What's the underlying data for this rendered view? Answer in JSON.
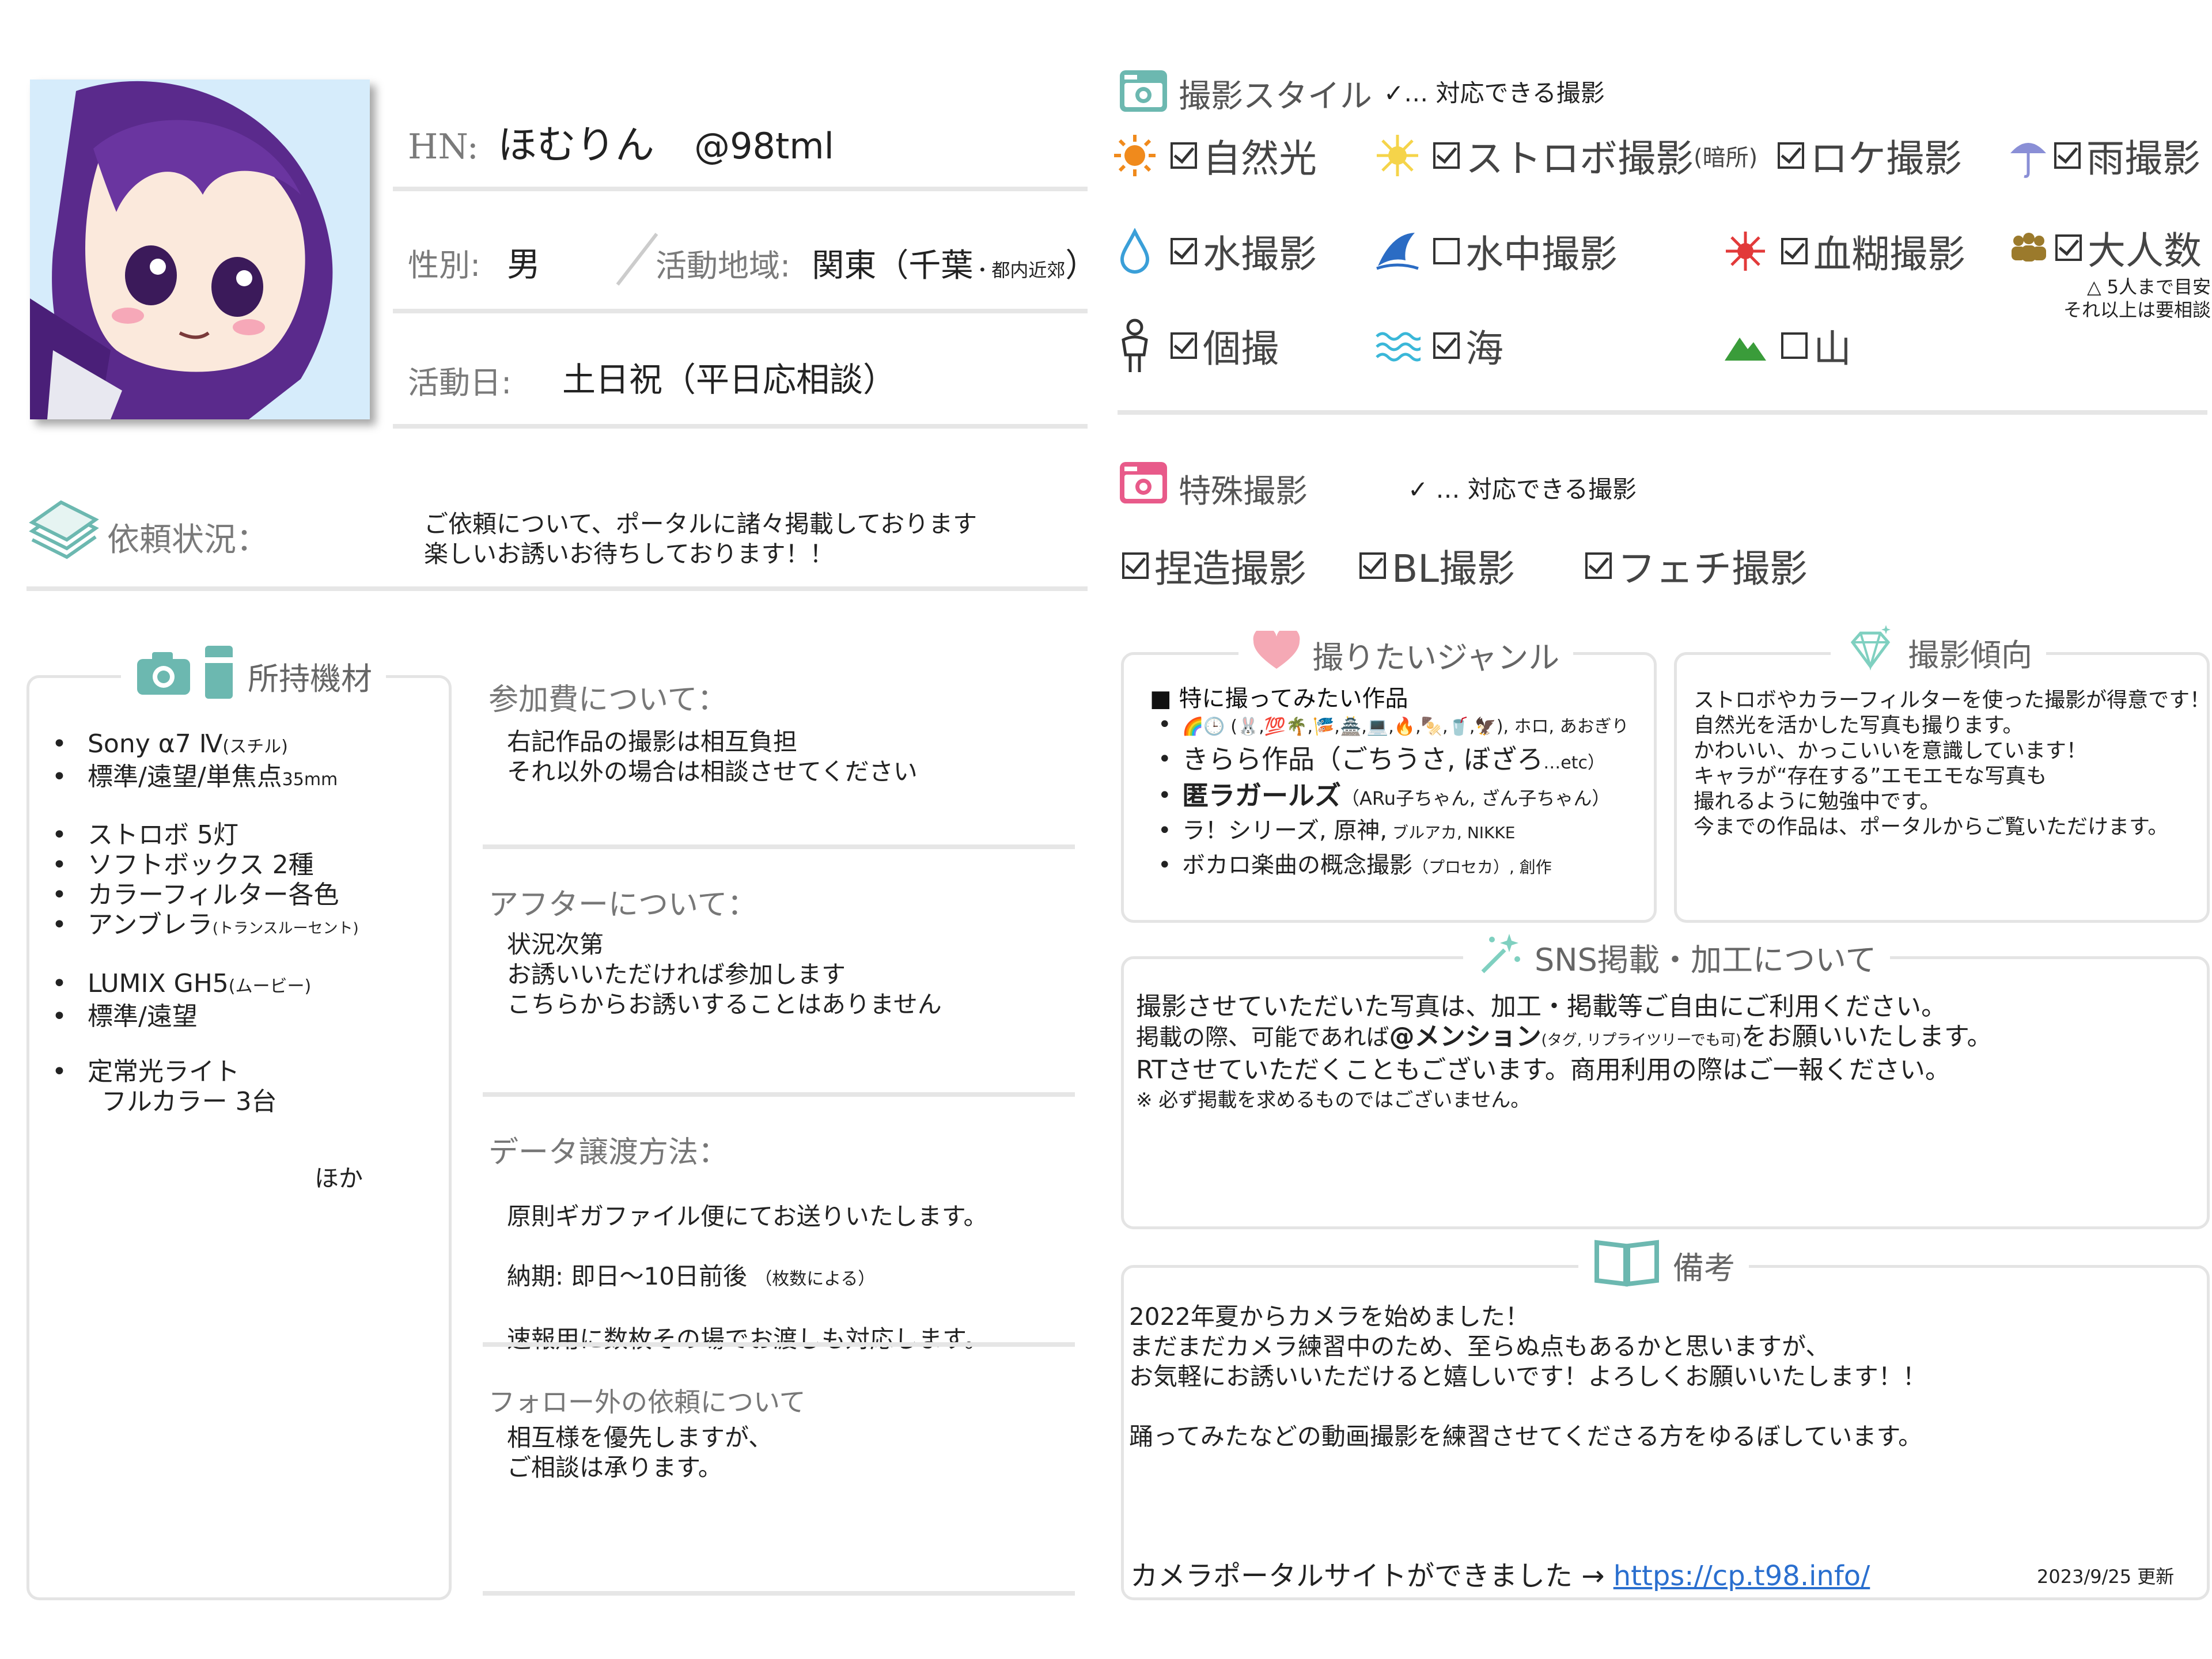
{
  "profile": {
    "hn_label": "HN:",
    "hn_name": "ほむりん",
    "handle": "@98tml",
    "gender_label": "性別:",
    "gender": "男",
    "area_label": "活動地域:",
    "area_main": "関東（千葉",
    "area_sub": "・都内近郊",
    "area_close": "）",
    "days_label": "活動日:",
    "days": "土日祝（平日応相談）"
  },
  "request": {
    "label": "依頼状況：",
    "lines": [
      "ご依頼について、ポータルに諸々掲載しております",
      "楽しいお誘いお待ちしております！！"
    ]
  },
  "equipment": {
    "title": "所持機材",
    "items": [
      {
        "text": "Sony α7 Ⅳ",
        "small": "(スチル)"
      },
      {
        "text": "標準/遠望/単焦点",
        "small": "35mm"
      },
      {
        "text": "ストロボ 5灯",
        "small": ""
      },
      {
        "text": "ソフトボックス 2種",
        "small": ""
      },
      {
        "text": "カラーフィルター各色",
        "small": ""
      },
      {
        "text": "アンブレラ",
        "small": "(トランスルーセント)"
      },
      {
        "text": "LUMIX GH5",
        "small": "(ムービー)"
      },
      {
        "text": "標準/遠望",
        "small": ""
      },
      {
        "text": "定常光ライト",
        "small": ""
      }
    ],
    "sub_item": "フルカラー 3台",
    "etc": "ほか"
  },
  "sections": [
    {
      "heading": "参加費について：",
      "body": "右記作品の撮影は相互負担\nそれ以外の場合は相談させてください"
    },
    {
      "heading": "アフターについて：",
      "body": "状況次第\nお誘いいただければ参加します\nこちらからお誘いすることはありません"
    },
    {
      "heading": "データ譲渡方法：",
      "body_lines": [
        "原則ギガファイル便にてお送りいたします。",
        "納期: 即日〜10日前後",
        "速報用に数枚その場でお渡しも対応します。"
      ],
      "body_small": "（枚数による）"
    },
    {
      "heading": "フォロー外の依頼について",
      "body": "相互様を優先しますが、\nご相談は承ります。"
    }
  ],
  "shoot_style": {
    "title": "撮影スタイル",
    "legend": "✓… 対応できる撮影",
    "items": [
      {
        "label": "自然光",
        "checked": true,
        "icon": "sun-icon",
        "color": "#f08a1c"
      },
      {
        "label": "ストロボ撮影",
        "small": "(暗所)",
        "checked": true,
        "icon": "flash-icon",
        "color": "#f5d44a"
      },
      {
        "label": "ロケ撮影",
        "checked": true,
        "icon": "",
        "color": "#444"
      },
      {
        "label": "雨撮影",
        "checked": true,
        "icon": "umbrella-icon",
        "color": "#8a8fd6"
      },
      {
        "label": "水撮影",
        "checked": true,
        "icon": "water-drop-icon",
        "color": "#3a9fd8"
      },
      {
        "label": "水中撮影",
        "checked": false,
        "icon": "shark-fin-icon",
        "color": "#2b6cc4"
      },
      {
        "label": "血糊撮影",
        "checked": true,
        "icon": "blood-splash-icon",
        "color": "#e23a3a"
      },
      {
        "label": "大人数",
        "checked": true,
        "icon": "group-icon",
        "color": "#9b7a2c"
      },
      {
        "label": "個撮",
        "checked": true,
        "icon": "person-icon",
        "color": "#444"
      },
      {
        "label": "海",
        "checked": true,
        "icon": "wave-icon",
        "color": "#3ab7d8"
      },
      {
        "label": "山",
        "checked": false,
        "icon": "mountain-icon",
        "color": "#3a9c3a"
      }
    ],
    "note_line1": "5人まで目安",
    "note_line2": "それ以上は要相談"
  },
  "special": {
    "title": "特殊撮影",
    "legend": "✓ … 対応できる撮影",
    "items": [
      "捏造撮影",
      "BL撮影",
      "フェチ撮影"
    ]
  },
  "genre": {
    "title": "撮りたいジャンル",
    "heading": "■ 特に撮ってみたい作品",
    "items": [
      {
        "main": "🌈🕒 (🐰,💯🌴,🎏,🏯,💻,🔥,🍢,🥤,🦅)",
        "small": ", ホロ, あおぎり"
      },
      {
        "main": "きらら作品（ごちうさ, ぼざろ",
        "small": "…etc）"
      },
      {
        "main": "匿ラガールズ",
        "small": "（ARu子ちゃん, ざん子ちゃん）"
      },
      {
        "main": "ラ！シリーズ, 原神,",
        "small": " ブルアカ, NIKKE"
      },
      {
        "main": "ボカロ楽曲の概念撮影",
        "small": "（プロセカ）, 創作"
      }
    ]
  },
  "tendency": {
    "title": "撮影傾向",
    "lines": [
      "ストロボやカラーフィルターを使った撮影が得意です！",
      "自然光を活かした写真も撮ります。",
      "かわいい、かっこいいを意識しています！",
      "キャラが“存在する”エモエモな写真も",
      "撮れるように勉強中です。",
      "今までの作品は、ポータルからご覧いただけます。"
    ]
  },
  "sns": {
    "title": "SNS掲載・加工について",
    "line1": "撮影させていただいた写真は、加工・掲載等ご自由にご利用ください。",
    "line2a": "掲載の際、可能であれば",
    "line2b": "@メンション",
    "line2c": "(タグ, リプライツリーでも可)",
    "line2d": "をお願いいたします。",
    "line3": "RTさせていただくこともございます。商用利用の際はご一報ください。",
    "note": "※ 必ず掲載を求めるものではございません。"
  },
  "remarks": {
    "title": "備考",
    "lines": [
      "2022年夏からカメラを始めました！",
      "まだまだカメラ練習中のため、至らぬ点もあるかと思いますが、",
      "お気軽にお誘いいただけると嬉しいです！よろしくお願いいたします！！",
      "",
      "踊ってみたなどの動画撮影を練習させてくださる方をゆるぼしています。"
    ],
    "portal_text": "カメラポータルサイトができました →",
    "portal_url": "https://cp.t98.info/",
    "updated": "2023/9/25 更新"
  },
  "colors": {
    "teal": "#6cb8b0",
    "pink": "#e85a8a",
    "avatar_bg": "#d6ecfb",
    "hair": "#5a2a8c"
  }
}
